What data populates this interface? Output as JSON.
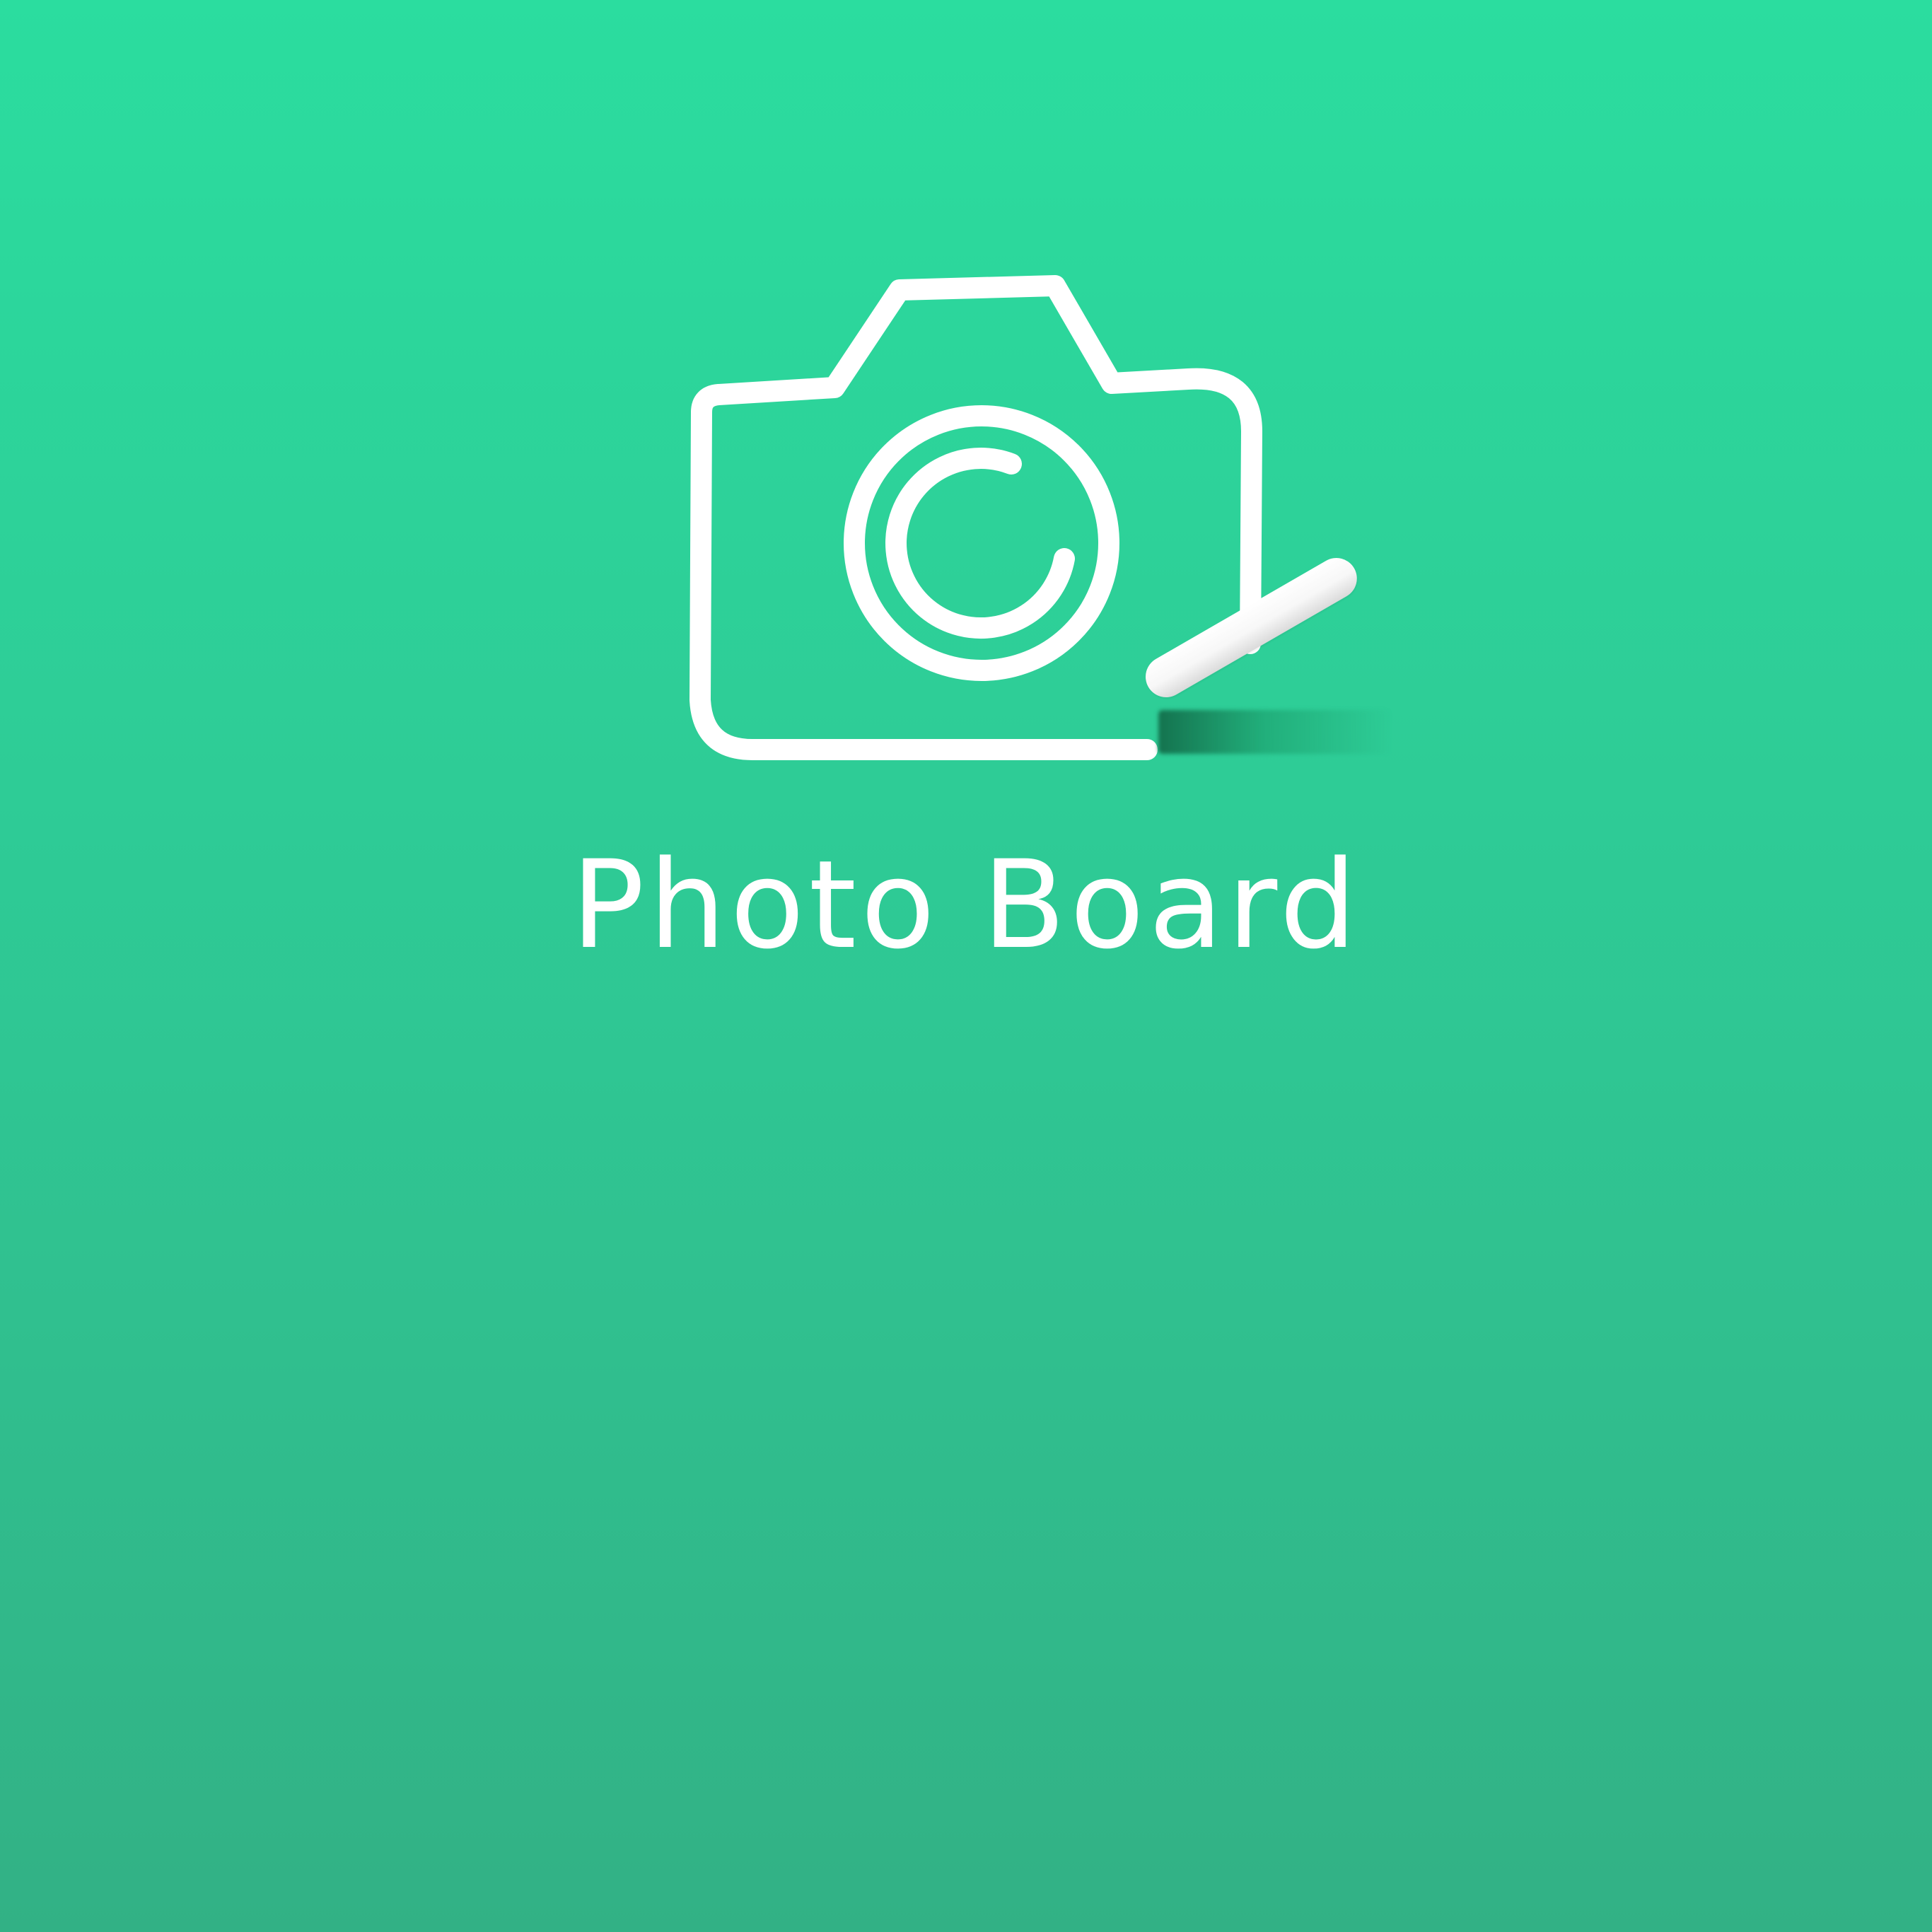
{
  "app": {
    "title": "Photo Board",
    "accent_color": "#2BDD9F",
    "logo_color": "#FFFFFF",
    "logo_icon": "camera-icon",
    "tool_icon": "chalk-icon"
  }
}
